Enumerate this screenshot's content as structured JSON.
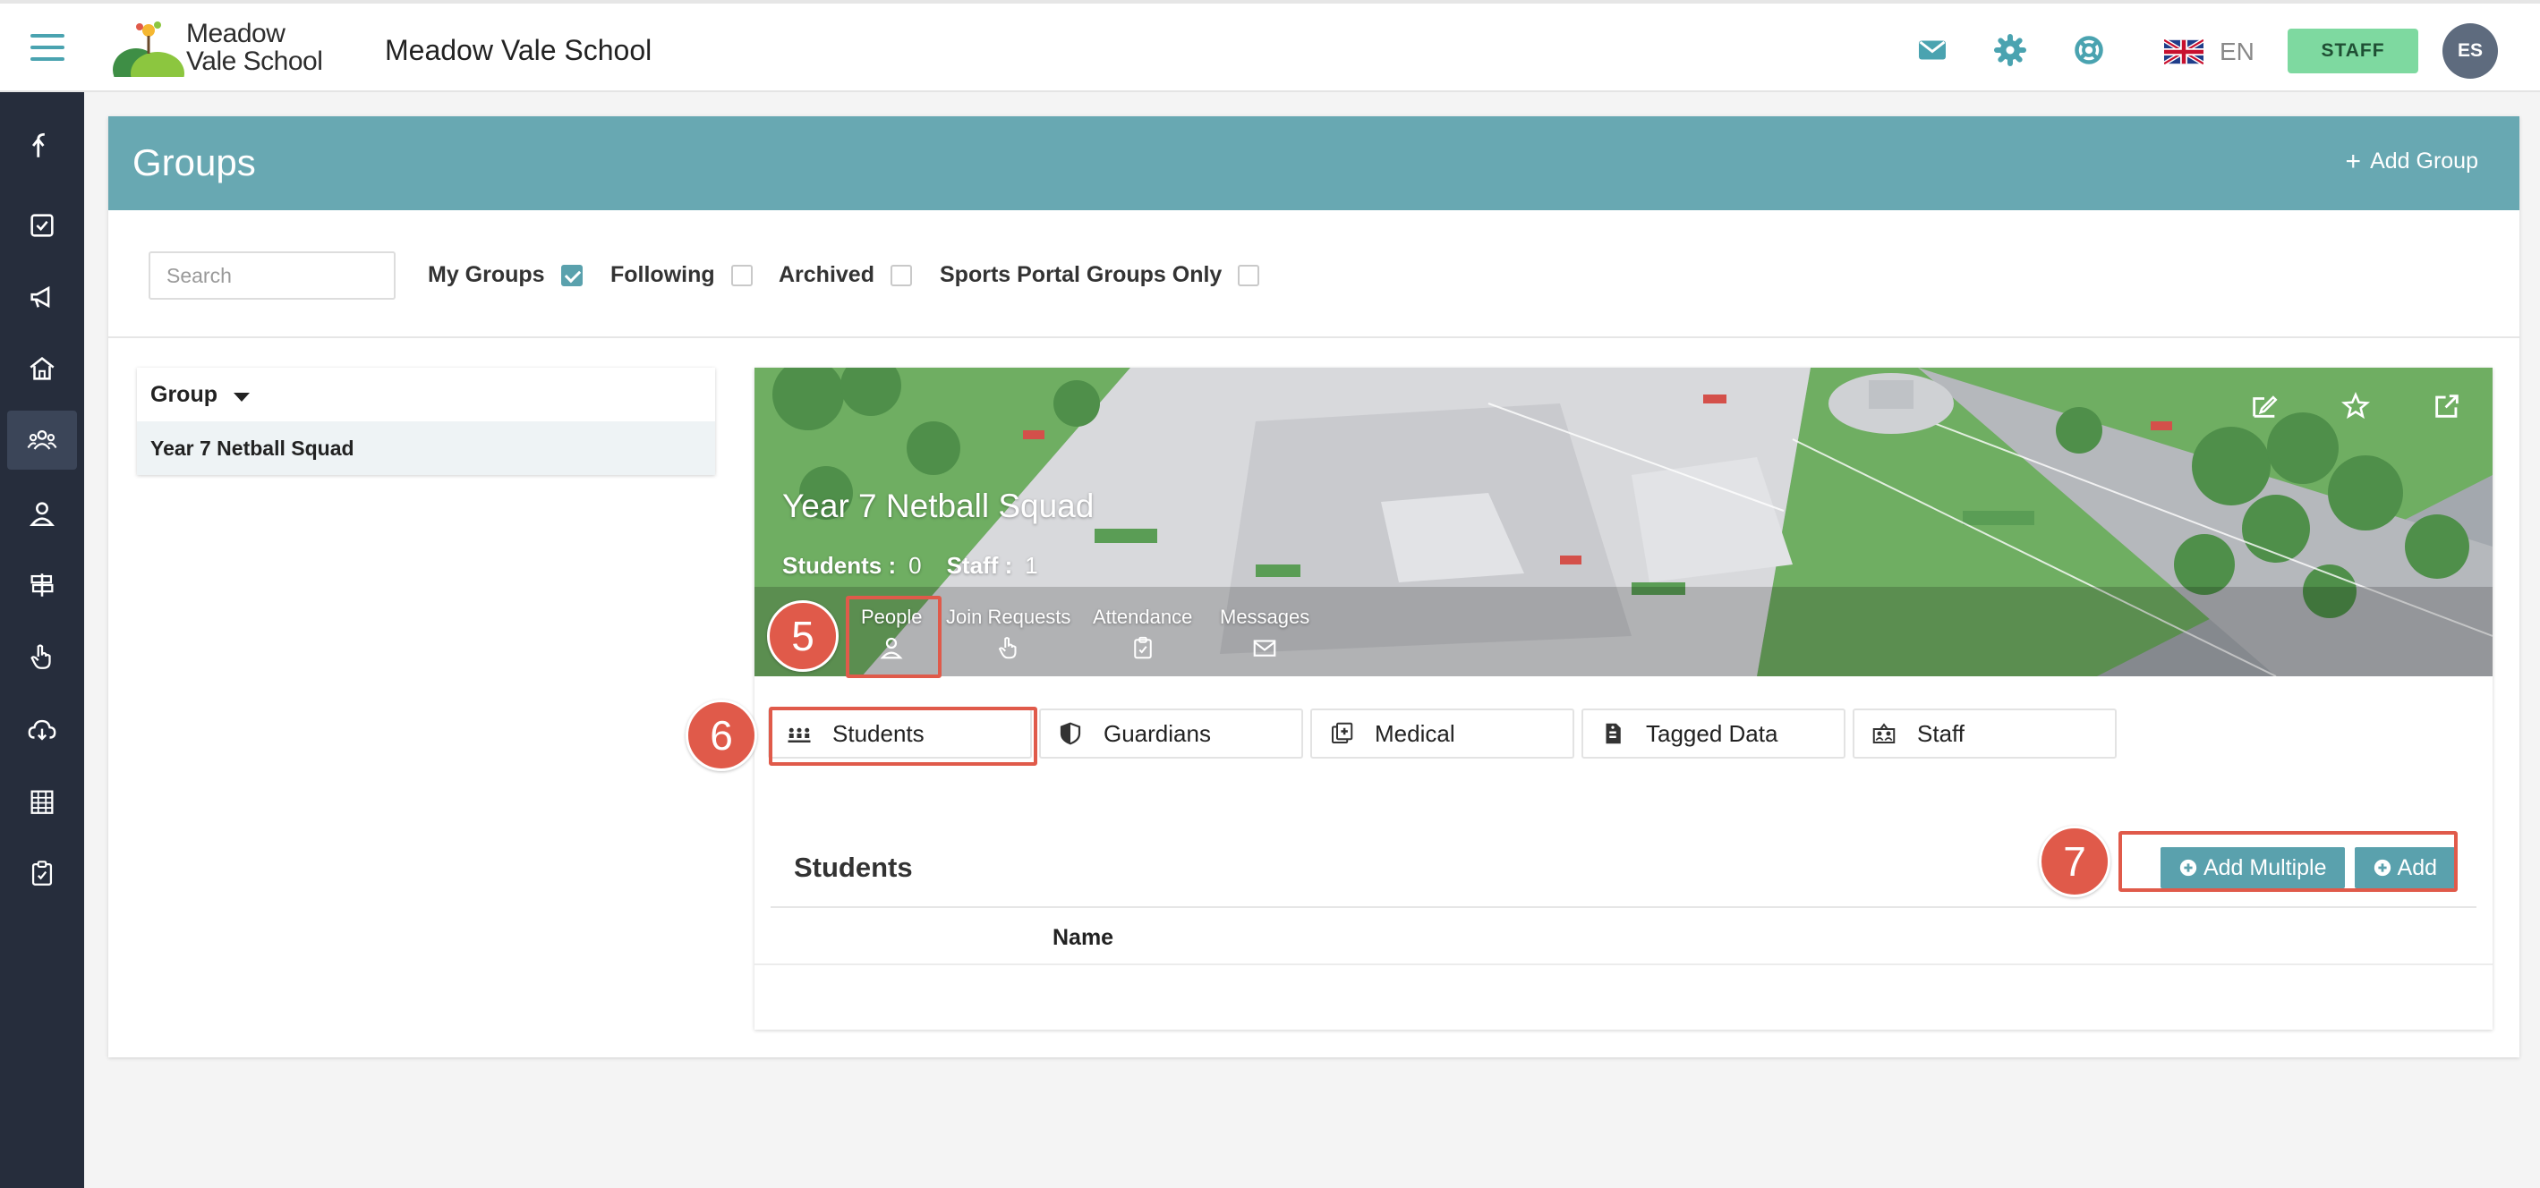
{
  "topbar": {
    "logo_text_line1": "Meadow",
    "logo_text_line2": "Vale School",
    "school_name": "Meadow Vale School",
    "lang": "EN",
    "role_button": "STAFF",
    "avatar_initials": "ES"
  },
  "groups": {
    "title": "Groups",
    "add_group": "Add Group"
  },
  "filters": {
    "search_placeholder": "Search",
    "my_groups": "My Groups",
    "my_groups_checked": true,
    "following": "Following",
    "archived": "Archived",
    "sports_only": "Sports Portal Groups Only"
  },
  "group_list": {
    "header": "Group",
    "rows": [
      "Year 7 Netball Squad"
    ]
  },
  "detail": {
    "title": "Year 7 Netball Squad",
    "students_label": "Students :",
    "students_count": "0",
    "staff_label": "Staff :",
    "staff_count": "1",
    "tabs": [
      "People",
      "Join Requests",
      "Attendance",
      "Messages"
    ]
  },
  "people_tabs": [
    "Students",
    "Guardians",
    "Medical",
    "Tagged Data",
    "Staff"
  ],
  "students_section": {
    "title": "Students",
    "add_multiple": "Add Multiple",
    "add": "Add",
    "name_column": "Name"
  },
  "annotations": [
    "5",
    "6",
    "7"
  ],
  "colors": {
    "accent": "#68a8b2",
    "button": "#5aa1ad",
    "staff_button": "#7ed9a0",
    "sidebar": "#262d3c",
    "annotation": "#e05a4a"
  }
}
